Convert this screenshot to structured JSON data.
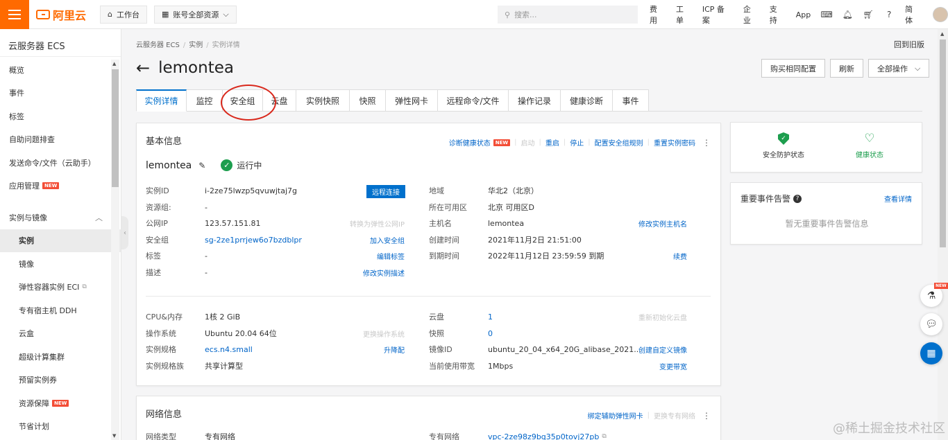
{
  "topbar": {
    "brand": "阿里云",
    "workbench": "工作台",
    "resources": "账号全部资源",
    "search_placeholder": "搜索...",
    "links": [
      "费用",
      "工单",
      "ICP 备案",
      "企业",
      "支持",
      "App"
    ],
    "lang": "简体"
  },
  "sidebar": {
    "title": "云服务器 ECS",
    "items_top": [
      "概览",
      "事件",
      "标签",
      "自助问题排查",
      "发送命令/文件（云助手）",
      "应用管理"
    ],
    "group": "实例与镜像",
    "sub_items": [
      "实例",
      "镜像",
      "弹性容器实例 ECI",
      "专有宿主机 DDH",
      "云盒",
      "超级计算集群",
      "预留实例券",
      "资源保障",
      "节省计划"
    ],
    "new_badge": "NEW"
  },
  "breadcrumb": [
    "云服务器 ECS",
    "实例",
    "实例详情"
  ],
  "back_old": "回到旧版",
  "page_title": "lemontea",
  "actions": {
    "buy_same": "购买相同配置",
    "refresh": "刷新",
    "all_ops": "全部操作"
  },
  "tabs": [
    "实例详情",
    "监控",
    "安全组",
    "云盘",
    "实例快照",
    "快照",
    "弹性网卡",
    "远程命令/文件",
    "操作记录",
    "健康诊断",
    "事件"
  ],
  "basic": {
    "title": "基本信息",
    "actions": {
      "diagnose": "诊断健康状态",
      "new": "NEW",
      "start": "启动",
      "restart": "重启",
      "stop": "停止",
      "config_sg": "配置安全组规则",
      "reset_pwd": "重置实例密码"
    },
    "instance_name": "lemontea",
    "status": "运行中",
    "remote_btn": "远程连接",
    "left_rows": [
      {
        "label": "实例ID",
        "value": "i-2ze75lwzp5qvuwjtaj7g",
        "action": ""
      },
      {
        "label": "资源组:",
        "value": "-",
        "action": ""
      },
      {
        "label": "公网IP",
        "value": "123.57.151.81",
        "action": "转换为弹性公网IP"
      },
      {
        "label": "安全组",
        "value": "sg-2ze1prrjew6o7bzdblpr",
        "action": "加入安全组"
      },
      {
        "label": "标签",
        "value": "-",
        "action": "编辑标签"
      },
      {
        "label": "描述",
        "value": "-",
        "action": "修改实例描述"
      }
    ],
    "right_rows": [
      {
        "label": "地域",
        "value": "华北2（北京）",
        "action": ""
      },
      {
        "label": "所在可用区",
        "value": "北京 可用区D",
        "action": ""
      },
      {
        "label": "主机名",
        "value": "lemontea",
        "action": "修改实例主机名"
      },
      {
        "label": "创建时间",
        "value": "2021年11月2日 21:51:00",
        "action": ""
      },
      {
        "label": "到期时间",
        "value": "2022年11月12日 23:59:59 到期",
        "action": "续费"
      }
    ],
    "left_rows2": [
      {
        "label": "CPU&内存",
        "value": "1核 2 GiB",
        "action": ""
      },
      {
        "label": "操作系统",
        "value": "Ubuntu 20.04 64位",
        "action": "更换操作系统"
      },
      {
        "label": "实例规格",
        "value": "ecs.n4.small",
        "action": "升降配"
      },
      {
        "label": "实例规格族",
        "value": "共享计算型",
        "action": ""
      }
    ],
    "right_rows2": [
      {
        "label": "云盘",
        "value": "1",
        "action": "重新初始化云盘"
      },
      {
        "label": "快照",
        "value": "0",
        "action": ""
      },
      {
        "label": "镜像ID",
        "value": "ubuntu_20_04_x64_20G_alibase_2021...",
        "action": "创建自定义镜像"
      },
      {
        "label": "当前使用带宽",
        "value": "1Mbps",
        "action": "变更带宽"
      }
    ]
  },
  "network": {
    "title": "网络信息",
    "bind_eni": "绑定辅助弹性网卡",
    "change_vpc": "更换专有网络",
    "type_label": "网络类型",
    "type_value": "专有网络",
    "vpc_label": "专有网络",
    "vpc_value": "vpc-2ze98z9bq35p0tovj27pb"
  },
  "status_card": {
    "security": "安全防护状态",
    "health": "健康状态"
  },
  "events_card": {
    "title": "重要事件告警",
    "link": "查看详情",
    "empty": "暂无重要事件告警信息"
  },
  "watermark": "@稀土掘金技术社区"
}
